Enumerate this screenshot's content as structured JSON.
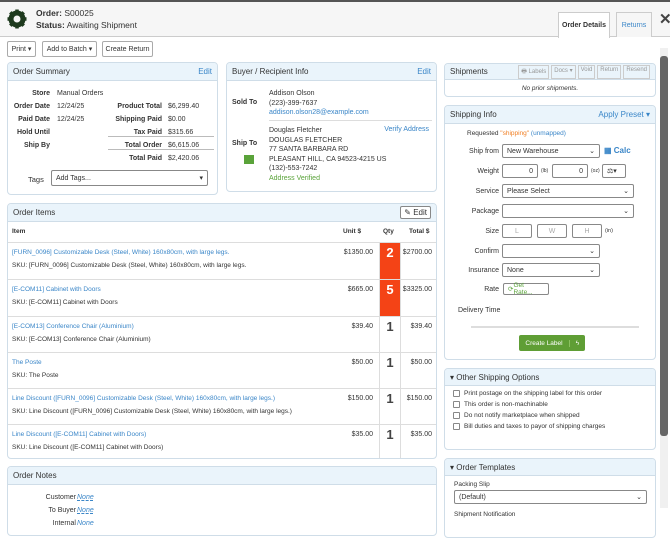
{
  "header": {
    "order_label": "Order:",
    "order_id": "S00025",
    "status_label": "Status:",
    "status": "Awaiting Shipment",
    "tabs": [
      "Order Details",
      "Returns"
    ]
  },
  "toolbar": {
    "print": "Print ▾",
    "add_to_batch": "Add to Batch ▾",
    "create_return": "Create Return"
  },
  "summary": {
    "title": "Order Summary",
    "edit": "Edit",
    "store_l": "Store",
    "store": "Manual Orders",
    "order_date_l": "Order Date",
    "order_date": "12/24/25",
    "paid_date_l": "Paid Date",
    "paid_date": "12/24/25",
    "hold_l": "Hold Until",
    "ship_by_l": "Ship By",
    "product_total_l": "Product Total",
    "product_total": "$6,299.40",
    "shipping_paid_l": "Shipping Paid",
    "shipping_paid": "$0.00",
    "tax_paid_l": "Tax Paid",
    "tax_paid": "$315.66",
    "total_order_l": "Total Order",
    "total_order": "$6,615.06",
    "total_paid_l": "Total Paid",
    "total_paid": "$2,420.06",
    "tags_l": "Tags",
    "tags_placeholder": "Add Tags..."
  },
  "buyer": {
    "title": "Buyer / Recipient Info",
    "edit": "Edit",
    "sold_to_l": "Sold To",
    "sold_name": "Addison Olson",
    "sold_phone": "(223)-399-7637",
    "sold_email": "addison.olson28@example.com",
    "ship_to_l": "Ship To",
    "verify": "Verify Address",
    "ship_lines": [
      "Douglas Fletcher",
      "DOUGLAS FLETCHER",
      "77 SANTA BARBARA RD",
      "PLEASANT HILL, CA 94523-4215 US",
      "(132)-553-7242"
    ],
    "verified": "Address Verified"
  },
  "items": {
    "title": "Order Items",
    "edit": "✎ Edit",
    "cols": [
      "Item",
      "Unit $",
      "Qty",
      "Total $"
    ],
    "rows": [
      {
        "name": "[FURN_0096] Customizable Desk (Steel, White) 160x80cm, with large legs.",
        "sku": "SKU: [FURN_0096] Customizable Desk (Steel, White) 160x80cm, with large legs.",
        "unit": "$1350.00",
        "qty": "2",
        "total": "$2700.00",
        "hl": true
      },
      {
        "name": "[E-COM11] Cabinet with Doors",
        "sku": "SKU: [E-COM11] Cabinet with Doors",
        "unit": "$665.00",
        "qty": "5",
        "total": "$3325.00",
        "hl": true
      },
      {
        "name": "[E-COM13] Conference Chair (Aluminium)",
        "sku": "SKU: [E-COM13] Conference Chair (Aluminium)",
        "unit": "$39.40",
        "qty": "1",
        "total": "$39.40",
        "hl": false
      },
      {
        "name": "The Poste",
        "sku": "SKU: The Poste",
        "unit": "$50.00",
        "qty": "1",
        "total": "$50.00",
        "hl": false
      },
      {
        "name": "Line Discount ([FURN_0096] Customizable Desk (Steel, White) 160x80cm, with large legs.)",
        "sku": "SKU: Line Discount ([FURN_0096] Customizable Desk (Steel, White) 160x80cm, with large legs.)",
        "unit": "$150.00",
        "qty": "1",
        "total": "$150.00",
        "hl": false
      },
      {
        "name": "Line Discount ([E-COM11] Cabinet with Doors)",
        "sku": "SKU: Line Discount ([E-COM11] Cabinet with Doors)",
        "unit": "$35.00",
        "qty": "1",
        "total": "$35.00",
        "hl": false
      }
    ]
  },
  "notes": {
    "title": "Order Notes",
    "customer_l": "Customer",
    "to_buyer_l": "To Buyer",
    "internal_l": "Internal",
    "none": "None"
  },
  "shipments": {
    "title": "Shipments",
    "labels": "🖶 Labels",
    "docs": "Docs ▾",
    "void": "Void",
    "return": "Return",
    "resend": "Resend",
    "empty": "No prior shipments."
  },
  "shipping": {
    "title": "Shipping Info",
    "preset": "Apply Preset ▾",
    "requested_l": "Requested",
    "requested": "\"shipping\"",
    "unmapped": "(unmapped)",
    "ship_from_l": "Ship from",
    "ship_from": "New Warehouse",
    "calc": "Calc",
    "weight_l": "Weight",
    "lb": "0",
    "lb_u": "(lb)",
    "oz": "0",
    "oz_u": "(oz)",
    "service_l": "Service",
    "service": "Please Select",
    "package_l": "Package",
    "size_l": "Size",
    "L": "L",
    "W": "W",
    "H": "H",
    "in": "(in)",
    "confirm_l": "Confirm",
    "insurance_l": "Insurance",
    "insurance": "None",
    "rate_l": "Rate",
    "get_rate": "Get Rate...",
    "delivery_l": "Delivery Time",
    "create_label": "Create Label"
  },
  "other": {
    "title": "Other Shipping Options",
    "options": [
      "Print postage on the shipping label for this order",
      "This order is non-machinable",
      "Do not notify marketplace when shipped",
      "Bill duties and taxes to payor of shipping charges"
    ]
  },
  "templates": {
    "title": "Order Templates",
    "packing_l": "Packing Slip",
    "packing": "(Default)",
    "notification_l": "Shipment Notification"
  }
}
